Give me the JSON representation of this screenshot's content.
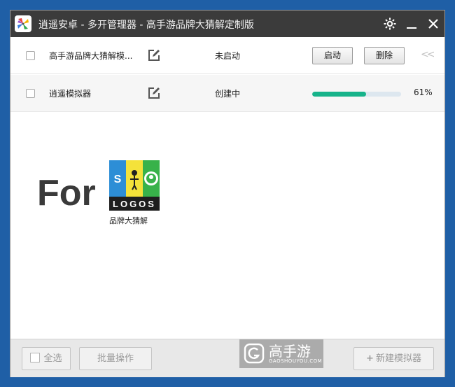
{
  "window": {
    "title": "逍遥安卓 - 多开管理器 - 高手游品牌大猜解定制版"
  },
  "instances": [
    {
      "name": "高手游品牌大猜解模...",
      "status": "未启动",
      "start_label": "启动",
      "delete_label": "删除",
      "collapse_glyph": "<<"
    },
    {
      "name": "逍遥模拟器",
      "status": "创建中",
      "progress": 0.61,
      "progress_text": "61%"
    }
  ],
  "promo": {
    "for_text": "For",
    "logo_text": "LOGOS",
    "logo_s": "S",
    "caption": "品牌大猜解"
  },
  "footer": {
    "select_all_label": "全选",
    "batch_label": "批量操作",
    "new_label": "新建模拟器",
    "new_prefix": "+"
  },
  "watermark": {
    "name": "高手游",
    "sub": "GAOSHOUYOU.COM"
  },
  "colors": {
    "titlebar": "#3b3b3b",
    "progress_fill": "#17b38a",
    "progress_track": "#dde7ef",
    "desktop": "#1f5fa6"
  }
}
